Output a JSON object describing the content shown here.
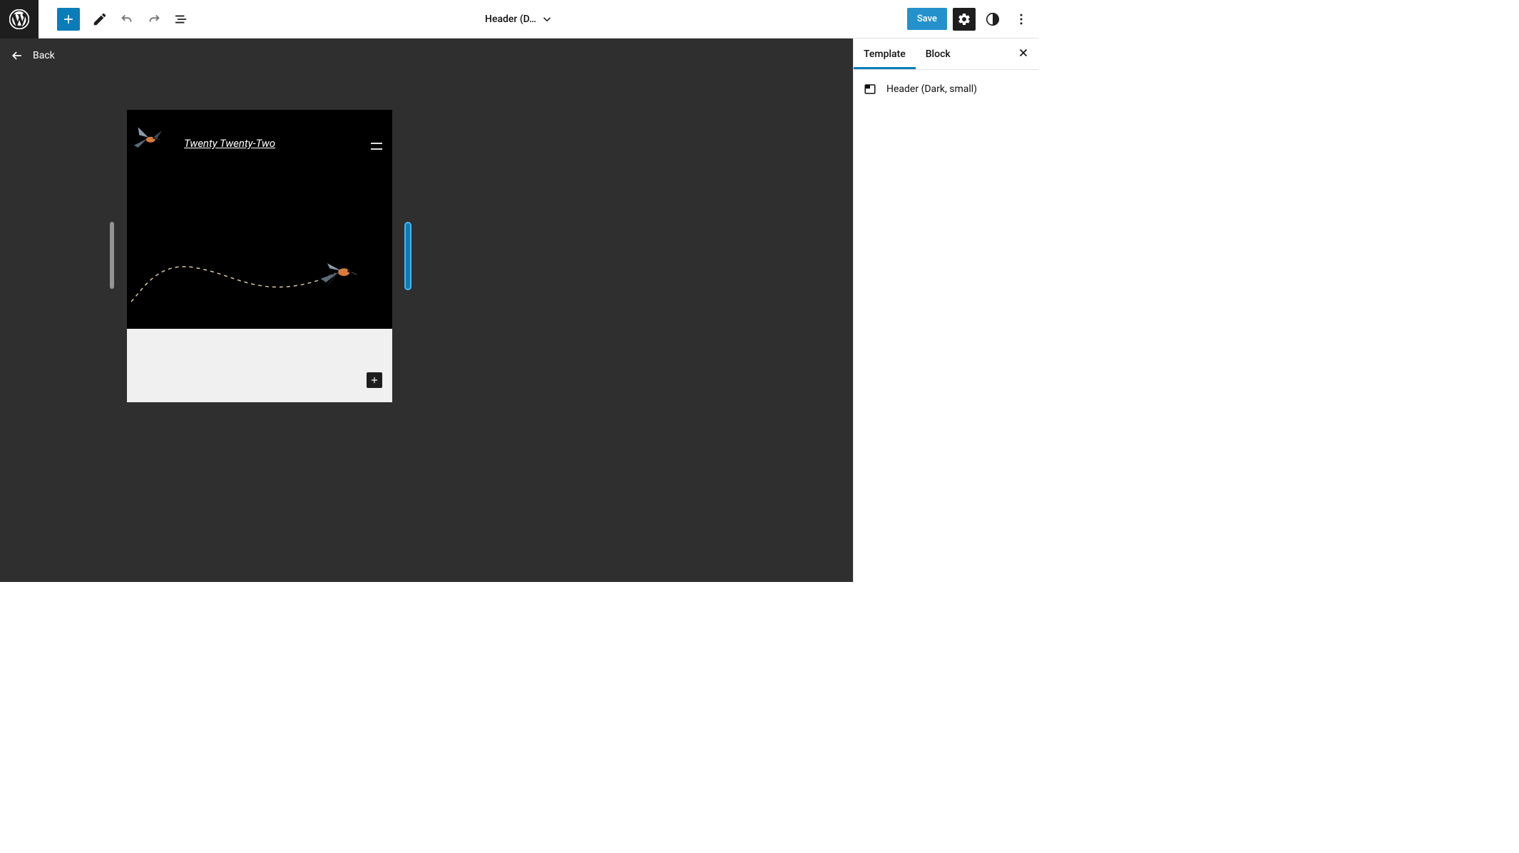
{
  "toolbar": {
    "document_title": "Header (D…",
    "save_label": "Save"
  },
  "canvas": {
    "back_label": "Back",
    "site_title": "Twenty Twenty-Two"
  },
  "sidebar": {
    "tabs": [
      {
        "label": "Template",
        "active": true
      },
      {
        "label": "Block",
        "active": false
      }
    ],
    "template_name": "Header (Dark, small)"
  }
}
